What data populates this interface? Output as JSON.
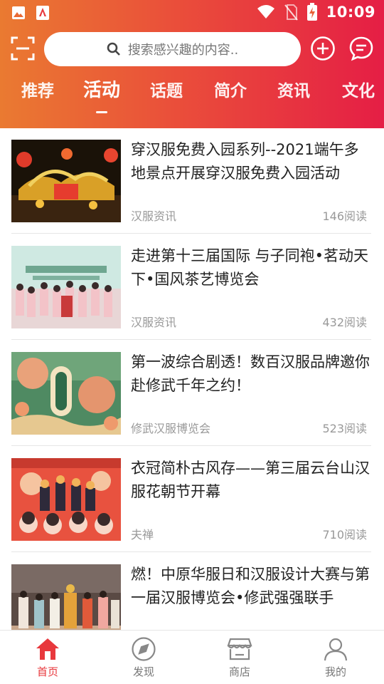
{
  "status_bar": {
    "time": "10:09"
  },
  "search": {
    "placeholder": "搜索感兴趣的内容.."
  },
  "tabs": [
    {
      "label": "推荐"
    },
    {
      "label": "活动"
    },
    {
      "label": "话题"
    },
    {
      "label": "简介"
    },
    {
      "label": "资讯"
    },
    {
      "label": "文化"
    }
  ],
  "active_tab": "活动",
  "articles": [
    {
      "title": "穿汉服免费入园系列--2021端午多地景点开展穿汉服免费入园活动",
      "source": "汉服资讯",
      "reads": "146阅读"
    },
    {
      "title": "走进第十三届国际 与子同袍•茗动天下•国风茶艺博览会",
      "source": "汉服资讯",
      "reads": "432阅读"
    },
    {
      "title": "第一波综合剧透！数百汉服品牌邀你赴修武千年之约！",
      "source": "修武汉服博览会",
      "reads": "523阅读"
    },
    {
      "title": "衣冠简朴古风存——第三届云台山汉服花朝节开幕",
      "source": "夫禅",
      "reads": "710阅读"
    },
    {
      "title": "燃！中原华服日和汉服设计大赛与第一届汉服博览会•修武强强联手",
      "source": "",
      "reads": ""
    }
  ],
  "bottom_nav": [
    {
      "label": "首页"
    },
    {
      "label": "发现"
    },
    {
      "label": "商店"
    },
    {
      "label": "我的"
    }
  ],
  "colors": {
    "gradient_start": "#ea7a31",
    "gradient_end": "#e51e45",
    "active_nav": "#e8383d"
  }
}
